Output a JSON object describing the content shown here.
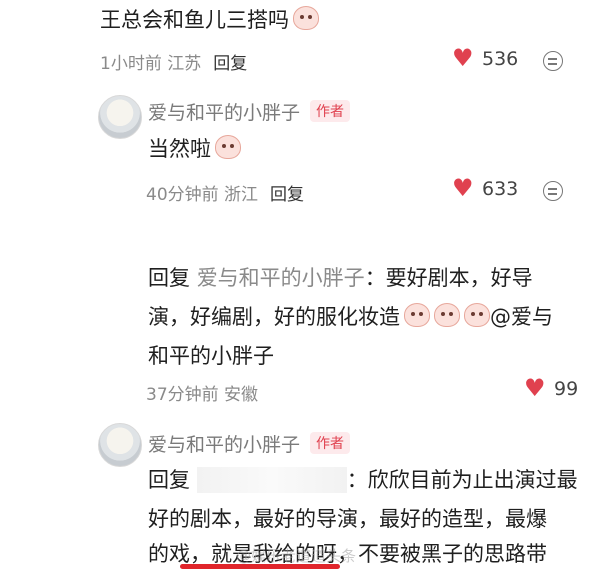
{
  "comment1": {
    "text": "王总会和鱼儿三搭吗",
    "meta": "1小时前 江苏",
    "reply_label": "回复",
    "likes": "536"
  },
  "reply1": {
    "author": "爱与和平的小胖子",
    "author_tag": "作者",
    "text": "当然啦",
    "meta": "40分钟前 浙江",
    "reply_label": "回复",
    "likes": "633"
  },
  "reply2": {
    "prefix": "回复",
    "mention": "爱与和平的小胖子",
    "line1_rest": "：要好剧本，好导",
    "line2": "演，好编剧，好的服化妆造",
    "line2_mention": "@爱与",
    "line3": "和平的小胖子",
    "meta": "37分钟前 安徽",
    "likes": "99"
  },
  "reply3": {
    "author": "爱与和平的小胖子",
    "author_tag": "作者",
    "prefix": "回复",
    "line1_rest": "：欣欣目前为止出演过最",
    "line2": "好的剧本，最好的导演，最好的造型，最爆",
    "line3": "的戏，就是我给的呀，不要被黑子的思路带"
  },
  "watermark": "@娱乐老道道头条"
}
